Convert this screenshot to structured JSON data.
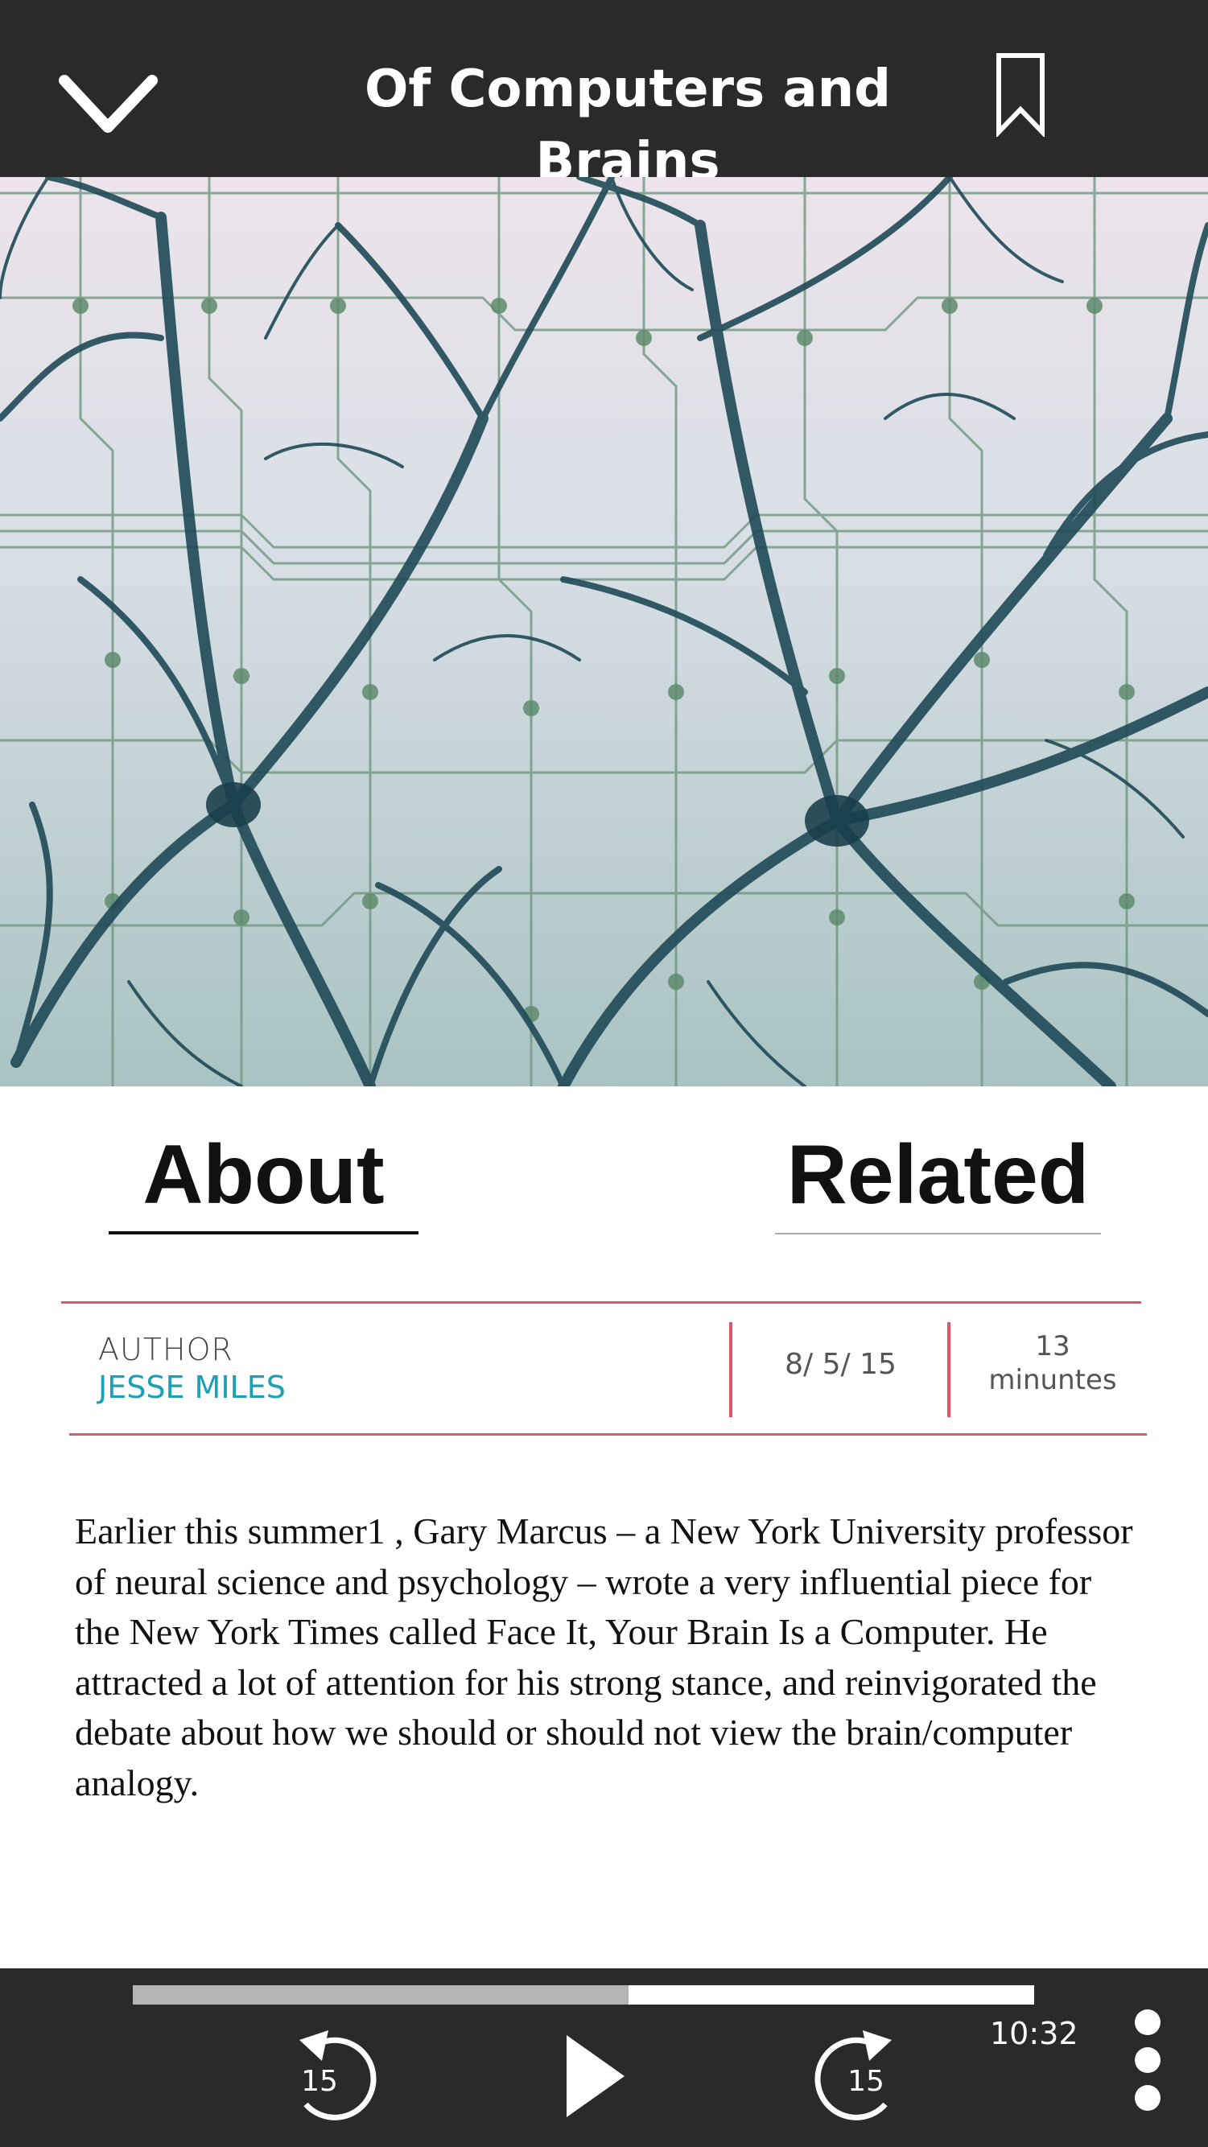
{
  "header": {
    "title": "Of Computers and Brains",
    "back_icon": "chevron-down-icon",
    "bookmark_icon": "bookmark-icon"
  },
  "hero": {
    "image": "neurons-over-circuit-board-illustration"
  },
  "tabs": [
    {
      "label": "About",
      "active": true
    },
    {
      "label": "Related",
      "active": false
    }
  ],
  "meta": {
    "author_label": "AUTHOR",
    "author_name": "JESSE MILES",
    "date": "8/ 5/ 15",
    "duration_number": "13",
    "duration_unit": "minuntes"
  },
  "article": {
    "body": "Earlier this summer1 , Gary Marcus – a New York University professor of neural science and psychology –  wrote a very influential piece for the New York Times called Face It, Your Brain Is a Computer. He attracted a lot of attention for his strong stance, and reinvigorated the debate about how we should or should not view the brain/computer analogy."
  },
  "player": {
    "progress": 0.55,
    "rewind_seconds": "15",
    "forward_seconds": "15",
    "time": "10:32",
    "play_icon": "play-icon",
    "more_icon": "more-vertical-icon"
  },
  "colors": {
    "bar_bg": "#2a2a2a",
    "accent_red": "#e25566",
    "author_teal": "#1aa1b5"
  }
}
